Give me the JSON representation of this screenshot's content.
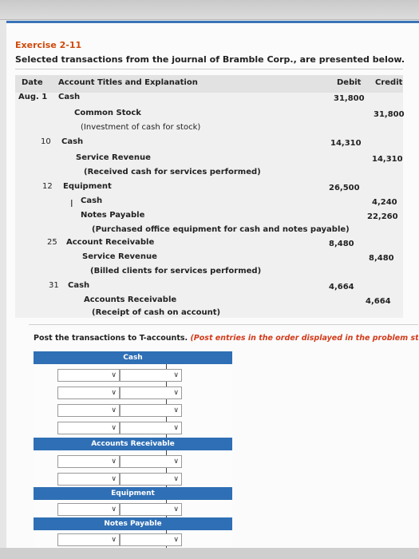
{
  "exercise": {
    "title": "Exercise 2-11",
    "subtitle": "Selected transactions from the journal of Bramble Corp., are presented below."
  },
  "journal": {
    "headers": {
      "date": "Date",
      "account": "Account Titles and Explanation",
      "debit": "Debit",
      "credit": "Credit"
    },
    "rows": [
      {
        "date": "Aug. 1",
        "account": "Cash",
        "debit": "31,800",
        "credit": ""
      },
      {
        "date": "",
        "account": "Common Stock",
        "debit": "",
        "credit": "31,800"
      },
      {
        "date": "",
        "account": "(Investment of cash for stock)",
        "debit": "",
        "credit": ""
      },
      {
        "date": "10",
        "account": "Cash",
        "debit": "14,310",
        "credit": ""
      },
      {
        "date": "",
        "account": "Service Revenue",
        "debit": "",
        "credit": "14,310"
      },
      {
        "date": "",
        "account": "(Received cash for services performed)",
        "debit": "",
        "credit": ""
      },
      {
        "date": "12",
        "account": "Equipment",
        "debit": "26,500",
        "credit": ""
      },
      {
        "date": "",
        "account": "Cash",
        "debit": "",
        "credit": "4,240"
      },
      {
        "date": "",
        "account": "Notes Payable",
        "debit": "",
        "credit": "22,260"
      },
      {
        "date": "",
        "account": "(Purchased office equipment for cash and notes payable)",
        "debit": "",
        "credit": ""
      },
      {
        "date": "25",
        "account": "Account Receivable",
        "debit": "8,480",
        "credit": ""
      },
      {
        "date": "",
        "account": "Service Revenue",
        "debit": "",
        "credit": "8,480"
      },
      {
        "date": "",
        "account": "(Billed clients for services performed)",
        "debit": "",
        "credit": ""
      },
      {
        "date": "31",
        "account": "Cash",
        "debit": "4,664",
        "credit": ""
      },
      {
        "date": "",
        "account": "Accounts Receivable",
        "debit": "",
        "credit": "4,664"
      },
      {
        "date": "",
        "account": "(Receipt of cash on account)",
        "debit": "",
        "credit": ""
      }
    ]
  },
  "instruction": {
    "main": "Post the transactions to T-accounts.",
    "note": "(Post entries in the order displayed in the problem statemen"
  },
  "taccounts": [
    {
      "name": "Cash"
    },
    {
      "name": "Accounts Receivable"
    },
    {
      "name": "Equipment"
    },
    {
      "name": "Notes Payable"
    }
  ],
  "icons": {
    "dropdown": "chevron-down-icon"
  }
}
